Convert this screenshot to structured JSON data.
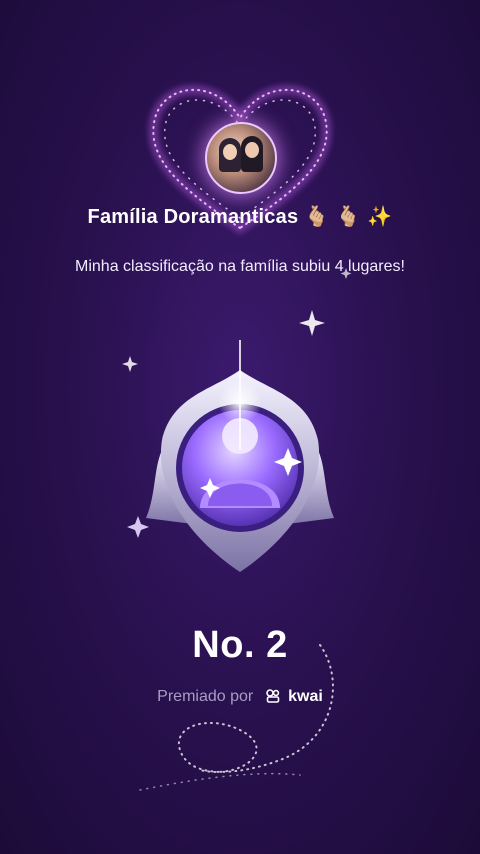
{
  "header": {
    "family_name": "Família Doramanticas",
    "family_emojis": "🫰🏼 🫰🏼 ✨"
  },
  "message": "Minha classificação na família subiu 4 lugares!",
  "rank": "No. 2",
  "footer": {
    "awarded_by": "Premiado por",
    "brand": "kwai"
  },
  "icons": {
    "avatar": "couple-avatar",
    "heart": "sparkle-heart-frame",
    "badge": "silver-rank-badge-icon",
    "kwai_logo": "kwai-logo-icon"
  },
  "colors": {
    "background": "#2a1150",
    "accent": "#c88cff",
    "muted_text": "#a99cc4"
  }
}
